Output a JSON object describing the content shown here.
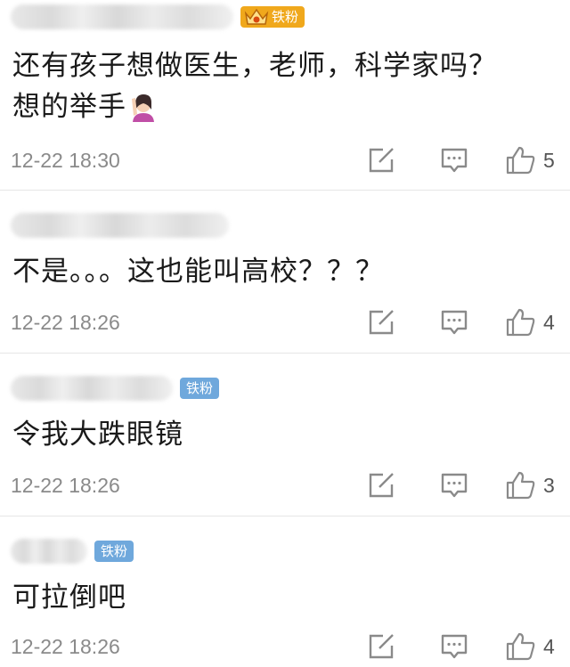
{
  "comments": [
    {
      "badge": "铁粉",
      "badge_type": "gold",
      "text_line1": "还有孩子想做医生，老师，科学家吗？",
      "text_line2": "想的举手",
      "emoji": "raising-hand-woman",
      "time": "12-22 18:30",
      "likes": "5"
    },
    {
      "badge": "",
      "badge_type": "none",
      "text_line1": "不是。。。这也能叫高校？？？",
      "time": "12-22 18:26",
      "likes": "4"
    },
    {
      "badge": "铁粉",
      "badge_type": "blue",
      "text_line1": "令我大跌眼镜",
      "time": "12-22 18:26",
      "likes": "3"
    },
    {
      "badge": "铁粉",
      "badge_type": "blue",
      "text_line1": "可拉倒吧",
      "time": "12-22 18:26",
      "likes": "4"
    }
  ],
  "icons": {
    "share": "share-edit-icon",
    "comment": "comment-icon",
    "like": "thumbs-up-icon"
  },
  "colors": {
    "fan_badge": "#6fa8dc",
    "gold_badge": "#f0a81c",
    "time_text": "#8a8a8a",
    "icon_stroke": "#8a8a8a"
  }
}
